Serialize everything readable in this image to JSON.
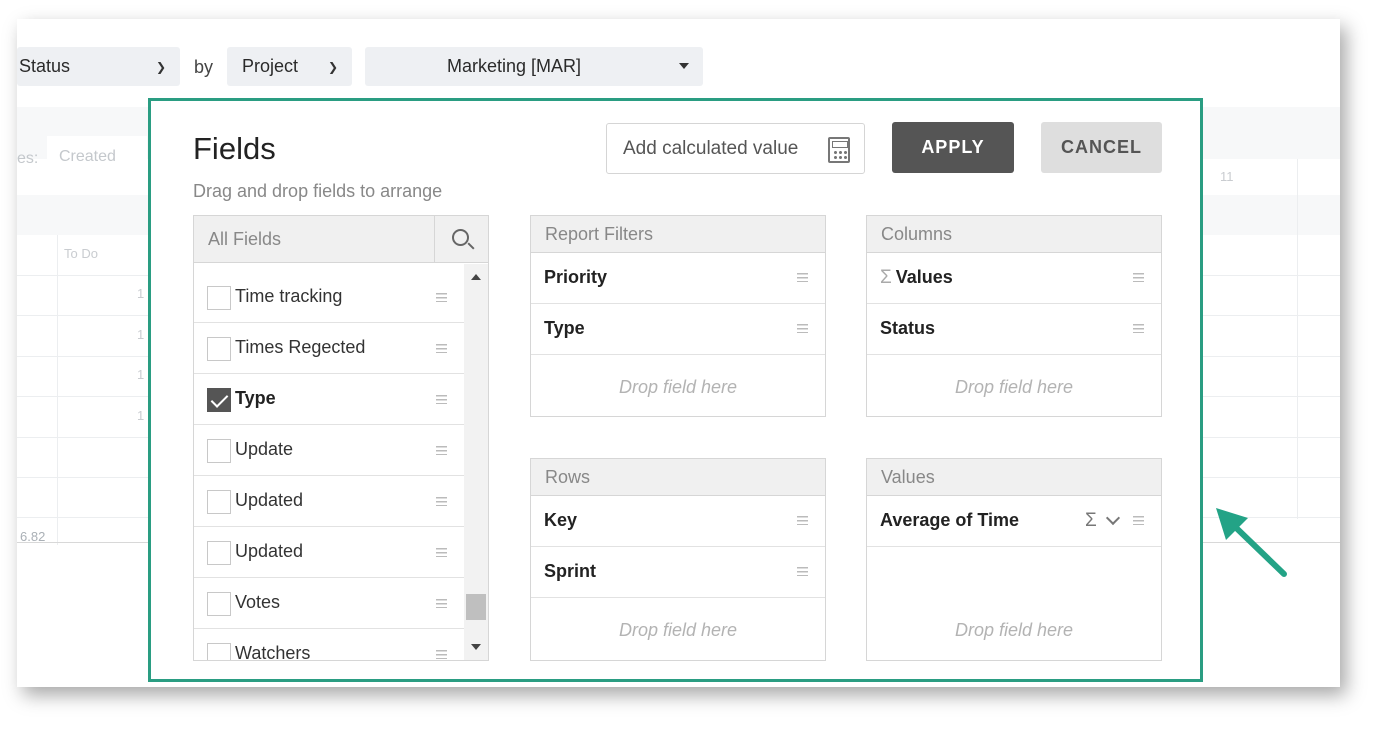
{
  "toolbar": {
    "status_select": "Status",
    "by_label": "by",
    "project_select": "Project",
    "project_value": "Marketing [MAR]"
  },
  "background": {
    "filter_label": "es:",
    "filter_value": "Created",
    "col_todo": "To Do",
    "row_prefix": "1",
    "total": "6.82",
    "col_number": "11"
  },
  "dialog": {
    "title": "Fields",
    "subtitle": "Drag and drop fields to arrange",
    "calculated_value_label": "Add calculated value",
    "apply_label": "APPLY",
    "cancel_label": "CANCEL",
    "all_fields_label": "All Fields",
    "fields": [
      {
        "label": "Time tracking",
        "checked": false
      },
      {
        "label": "Times Regected",
        "checked": false
      },
      {
        "label": "Type",
        "checked": true
      },
      {
        "label": "Update",
        "checked": false
      },
      {
        "label": "Updated",
        "checked": false
      },
      {
        "label": "Updated",
        "checked": false
      },
      {
        "label": "Votes",
        "checked": false
      },
      {
        "label": "Watchers",
        "checked": false
      }
    ],
    "report_filters": {
      "title": "Report Filters",
      "items": [
        "Priority",
        "Type"
      ],
      "drop_label": "Drop field here"
    },
    "columns": {
      "title": "Columns",
      "items": [
        "Values",
        "Status"
      ],
      "drop_label": "Drop field here"
    },
    "rows": {
      "title": "Rows",
      "items": [
        "Key",
        "Sprint"
      ],
      "drop_label": "Drop field here"
    },
    "values": {
      "title": "Values",
      "items": [
        "Average of Time"
      ],
      "drop_label": "Drop field here"
    }
  },
  "colors": {
    "dialog_border": "#2a9d82",
    "apply_bg": "#555555",
    "cancel_bg": "#dedede",
    "arrow": "#23a386"
  }
}
